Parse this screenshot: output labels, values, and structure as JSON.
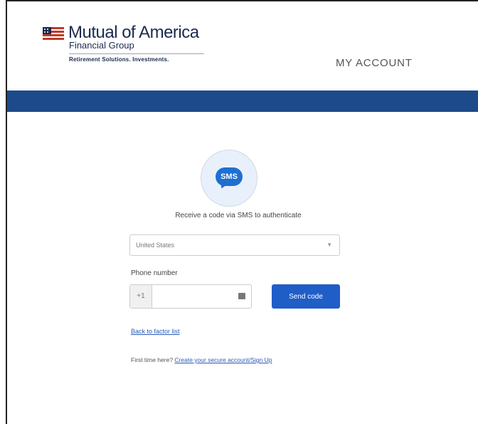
{
  "brand": {
    "name": "Mutual of America",
    "sub": "Financial Group",
    "tagline": "Retirement Solutions. Investments."
  },
  "header": {
    "my_account": "MY ACCOUNT"
  },
  "sms": {
    "icon_text": "SMS",
    "prompt": "Receive a code via SMS to authenticate"
  },
  "country_select": {
    "value": "United States"
  },
  "phone": {
    "label": "Phone number",
    "prefix": "+1",
    "value": "",
    "placeholder": ""
  },
  "send_button": {
    "label": "Send code"
  },
  "links": {
    "back": "Back to factor list",
    "first_time_text": "First time here?",
    "create_account": "Create your secure account/Sign Up"
  },
  "colors": {
    "brand_band": "#1c4a8a",
    "button": "#1f5ec7"
  }
}
